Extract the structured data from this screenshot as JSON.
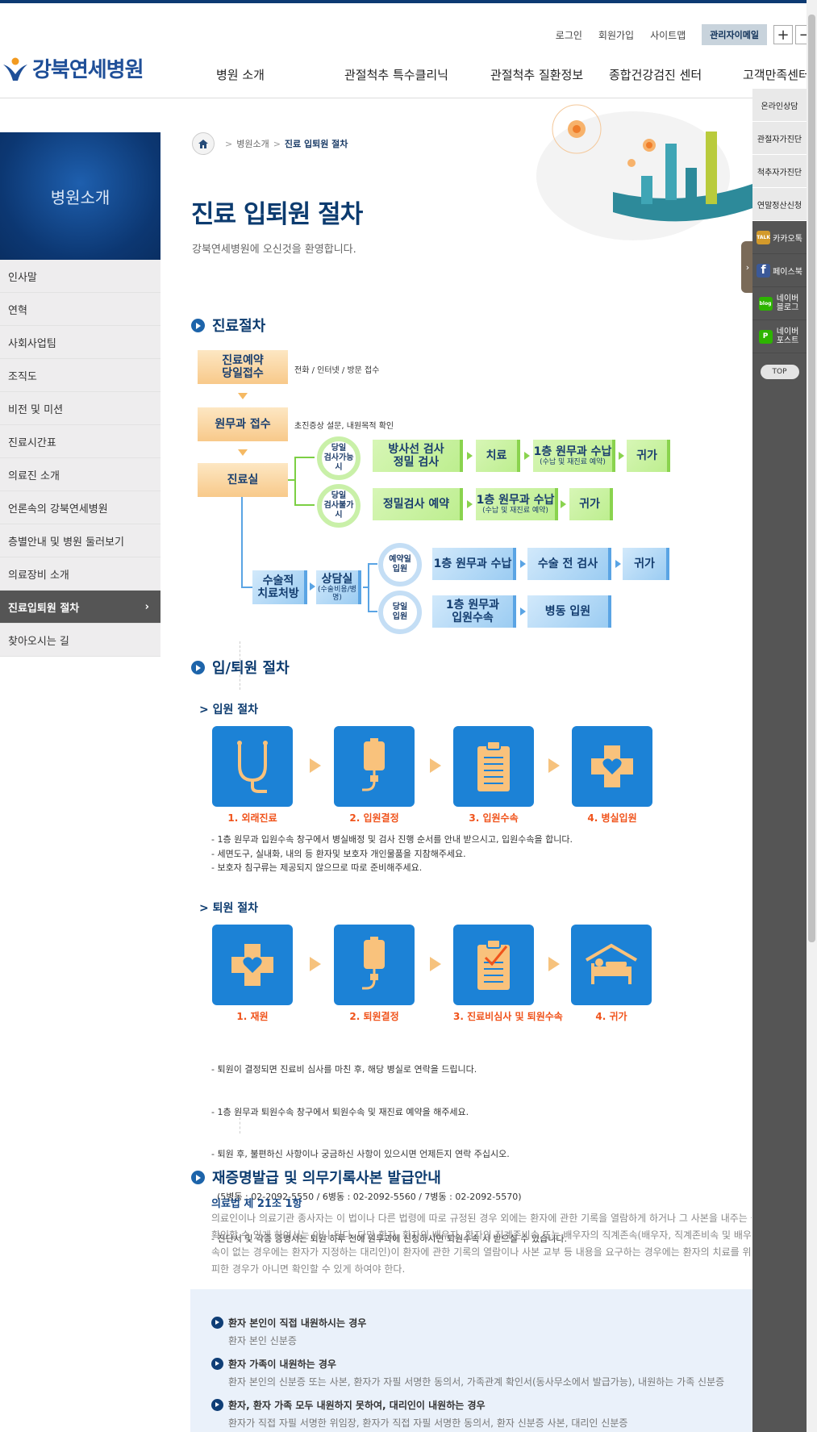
{
  "header": {
    "util": {
      "login": "로그인",
      "join": "회원가입",
      "sitemap": "사이트맵",
      "admin_mail": "관리자이메일",
      "zoom_in": "+",
      "zoom_out": "−"
    },
    "logo_text": "강북연세병원",
    "gnb": [
      "병원 소개",
      "관절척추 특수클리닉",
      "관절척추 질환정보",
      "종합건강검진 센터",
      "고객만족센터"
    ]
  },
  "sidebar": {
    "title": "병원소개",
    "items": [
      {
        "label": "인사말"
      },
      {
        "label": "연혁"
      },
      {
        "label": "사회사업팀"
      },
      {
        "label": "조직도"
      },
      {
        "label": "비전 및 미션"
      },
      {
        "label": "진료시간표"
      },
      {
        "label": "의료진 소개"
      },
      {
        "label": "언론속의 강북연세병원"
      },
      {
        "label": "층별안내 및 병원 둘러보기"
      },
      {
        "label": "의료장비 소개"
      },
      {
        "label": "진료입퇴원 절차",
        "active": true
      },
      {
        "label": "찾아오시는 길"
      }
    ],
    "active_chevron": "›"
  },
  "quick_menu": {
    "items": [
      "온라인상담",
      "관절자가진단",
      "척추자가진단",
      "연말정산신청"
    ],
    "social": [
      {
        "label": "카카오톡",
        "icon": "kakaotalk-icon",
        "badge": "TALK",
        "color": "#d39a2b"
      },
      {
        "label": "페이스북",
        "icon": "facebook-icon",
        "badge": "f",
        "color": "#3b5998"
      },
      {
        "label": "네이버 블로그",
        "icon": "naver-blog-icon",
        "badge": "blog",
        "color": "#2db400"
      },
      {
        "label": "네이버 포스트",
        "icon": "naver-post-icon",
        "badge": "P",
        "color": "#2db400"
      }
    ],
    "top": "TOP",
    "toggle": "›"
  },
  "breadcrumb": {
    "sep": ">",
    "parent": "병원소개",
    "current": "진료 입퇴원 절차"
  },
  "page": {
    "title": "진료 입퇴원 절차",
    "subtitle": "강북연세병원에 오신것을 환영합니다."
  },
  "sections": {
    "treatment": "진료절차",
    "admission": "입/퇴원 절차",
    "documents": "재증명발급 및 의무기록사본 발급안내"
  },
  "flow": {
    "reserve": "진료예약\n당일접수",
    "reserve_desc": "전화 / 인터넷 / 방문 접수",
    "reception": "원무과 접수",
    "reception_desc": "초진증상 설문, 내원목적 확인",
    "clinic": "진료실",
    "same_day_ok": "당일\n검사가능시",
    "same_day_no": "당일\n검사불가시",
    "xray": "방사선 검사\n정밀 검사",
    "treat": "치료",
    "pay1": "1층 원무과 수납",
    "pay1_small": "(수납 및 재진료 예약)",
    "home": "귀가",
    "precise_reserve": "정밀검사 예약",
    "pay2": "1층 원무과 수납",
    "pay2_small": "(수납 및 재진료 예약)",
    "home2": "귀가",
    "surgery": "수술적\n치료처방",
    "counsel": "상담실",
    "counsel_small": "(수술비용/병명)",
    "reserved_adm": "예약일\n입원",
    "sameday_adm": "당일\n입원",
    "pay3": "1층 원무과 수납",
    "pre_op": "수술 전 검사",
    "home3": "귀가",
    "adm_proc": "1층 원무과\n입원수속",
    "ward": "병동 입원"
  },
  "admission": {
    "title": "입원 절차",
    "steps": [
      {
        "label": "1. 외래진료",
        "icon": "stethoscope-icon"
      },
      {
        "label": "2. 입원결정",
        "icon": "iv-drip-icon"
      },
      {
        "label": "3. 입원수속",
        "icon": "clipboard-icon"
      },
      {
        "label": "4. 병실입원",
        "icon": "medical-cross-heart-icon"
      }
    ],
    "notes": [
      "- 1층 원무과 입원수속 창구에서 병실배정 및 검사 진행 순서를 안내 받으시고, 입원수속을 합니다.",
      "- 세면도구, 실내화, 내의 등 환자및 보호자 개인물품을 지참해주세요.",
      "- 보호자 침구류는 제공되지 않으므로 따로 준비해주세요."
    ]
  },
  "discharge": {
    "title": "퇴원 절차",
    "steps": [
      {
        "label": "1. 재원",
        "icon": "medical-cross-heart-icon"
      },
      {
        "label": "2. 퇴원결정",
        "icon": "iv-drip-icon"
      },
      {
        "label": "3. 진료비심사 및 퇴원수속",
        "icon": "checked-clipboard-icon"
      },
      {
        "label": "4. 귀가",
        "icon": "home-bed-icon"
      }
    ],
    "notes": [
      "- 퇴원이 결정되면 진료비 심사를 마친 후, 해당 병실로 연락을 드립니다.",
      "- 1층 원무과 퇴원수속 창구에서 퇴원수속 및 재진료 예약을 해주세요.",
      "- 퇴원 후, 불편하신 사항이나 궁금하신 사항이 있으시면 언제든지 연락 주십시오.",
      "  (5병동 : 02-2092-5550 / 6병동 : 02-2092-5560 / 7병동 : 02-2092-5570)",
      "- 진단서 및 각종 증명서는 퇴원 하루 전에 원무과에 신청하시면 퇴원수속 시 받으실 수 있습니다."
    ]
  },
  "law": {
    "title": "의료법 제 21조 1항",
    "lines": [
      "의료인이나 의료기관 종사자는 이 법이나 다른 법령에 따로 규정된 경우 외에는 환자에 관한 기록을 열람하게 하거나 그 사본을 내주는 등 내용을",
      "확인할 수 있게 하여서는 아니 된다. 다만 환자, 환자의 배우자, 환자의 직계존비속 또는 배우자의 직계존속(배우자, 직계존비속 및 배우자의 직계존",
      "속이 없는 경우에는 환자가 지정하는 대리인)이 환자에 관한 기록의 열람이나 사본 교부 등 내용을 요구하는 경우에는 환자의 치료를 위하여 불가",
      "피한 경우가 아니면 확인할 수 있게 하여야 한다."
    ]
  },
  "documents": [
    {
      "heading": "환자 본인이 직접 내원하시는 경우",
      "text": "환자 본인 신분증"
    },
    {
      "heading": "환자 가족이 내원하는 경우",
      "text": "환자 본인의 신분증 또는 사본, 환자가 자필 서명한 동의서, 가족관계 확인서(동사무소에서 발급가능), 내원하는 가족 신분증"
    },
    {
      "heading": "환자, 환자 가족 모두 내원하지 못하여, 대리인이 내원하는 경우",
      "text": "환자가 직접 자필 서명한 위임장, 환자가 직접 자필 서명한 동의서, 환자 신분증 사본, 대리인 신분증"
    }
  ],
  "colors": {
    "brand": "#0c3b6f",
    "accent_orange": "#f0531b",
    "step_blue": "#1c82d6"
  }
}
